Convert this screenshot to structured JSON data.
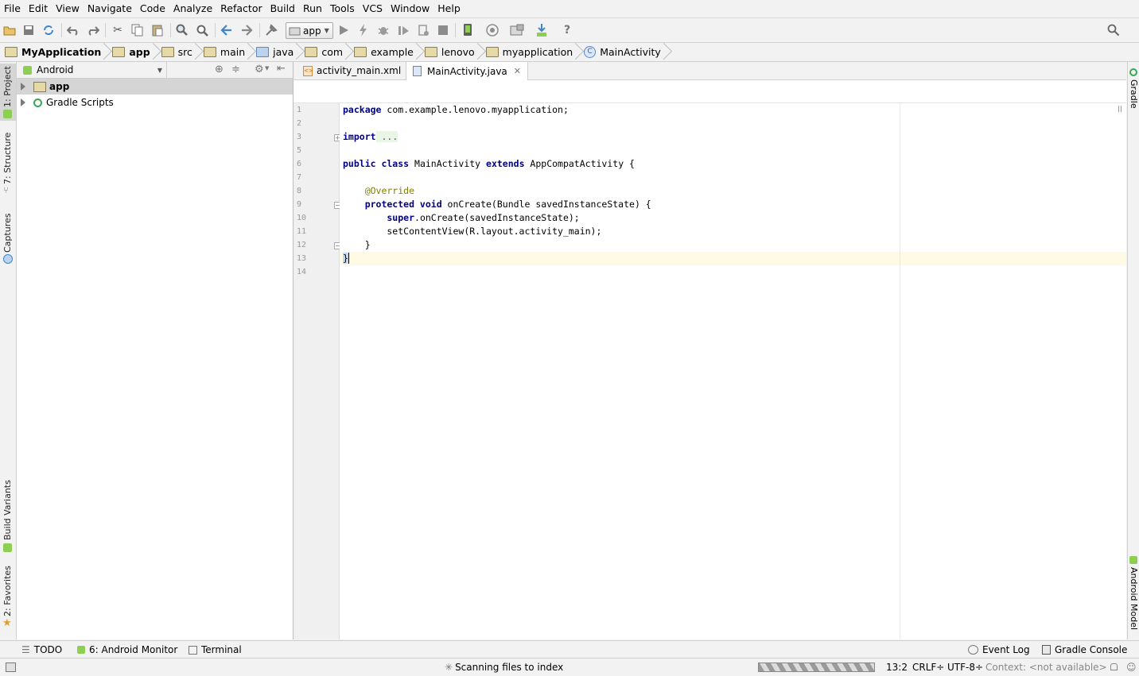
{
  "menu": [
    "File",
    "Edit",
    "View",
    "Navigate",
    "Code",
    "Analyze",
    "Refactor",
    "Build",
    "Run",
    "Tools",
    "VCS",
    "Window",
    "Help"
  ],
  "toolbar": {
    "run_config": "app",
    "icons": [
      "open-icon",
      "save-all-icon",
      "sync-icon",
      "undo-icon",
      "redo-icon",
      "cut-icon",
      "copy-icon",
      "paste-icon",
      "find-icon",
      "replace-icon",
      "back-icon",
      "forward-icon",
      "make-project-icon",
      "run-icon",
      "apply-changes-icon",
      "debug-icon",
      "attach-debugger-icon",
      "profile-icon",
      "stop-icon",
      "avd-manager-icon",
      "sync-gradle-icon",
      "project-structure-icon",
      "sdk-manager-icon",
      "help-icon",
      "search-everywhere-icon"
    ]
  },
  "breadcrumb": [
    "MyApplication",
    "app",
    "src",
    "main",
    "java",
    "com",
    "example",
    "lenovo",
    "myapplication",
    "MainActivity"
  ],
  "project_panel": {
    "view_selector": "Android",
    "tree": [
      {
        "label": "app",
        "selected": true
      },
      {
        "label": "Gradle Scripts",
        "selected": false
      }
    ]
  },
  "left_stripe": {
    "project": "1: Project",
    "structure": "7: Structure",
    "captures": "Captures",
    "build_variants": "Build Variants",
    "favorites": "2: Favorites"
  },
  "right_stripe": {
    "gradle": "Gradle",
    "android_model": "Android Model"
  },
  "editor": {
    "tabs": [
      {
        "label": "activity_main.xml",
        "active": false
      },
      {
        "label": "MainActivity.java",
        "active": true
      }
    ],
    "line_numbers": [
      "1",
      "2",
      "3",
      "5",
      "6",
      "7",
      "8",
      "9",
      "10",
      "11",
      "12",
      "13",
      "14"
    ],
    "code": {
      "l1_kw": "package",
      "l1": " com.example.lenovo.myapplication;",
      "l3_kw": "import",
      "l3": " ...",
      "l6_kw1": "public class",
      "l6_a": " MainActivity ",
      "l6_kw2": "extends",
      "l6_b": " AppCompatActivity {",
      "l8": "    @Override",
      "l9_kw": "    protected void",
      "l9": " onCreate(Bundle savedInstanceState) {",
      "l10_kw": "        super",
      "l10": ".onCreate(savedInstanceState);",
      "l11": "        setContentView(R.layout.activity_main);",
      "l12": "    }",
      "l13": "}"
    }
  },
  "bottom_tools": {
    "todo": "TODO",
    "android_monitor": "6: Android Monitor",
    "terminal": "Terminal",
    "event_log": "Event Log",
    "gradle_console": "Gradle Console"
  },
  "status": {
    "message": "Scanning files to index",
    "position": "13:2",
    "line_sep": "CRLF÷",
    "encoding": "UTF-8÷",
    "context": "Context: <not available>"
  }
}
